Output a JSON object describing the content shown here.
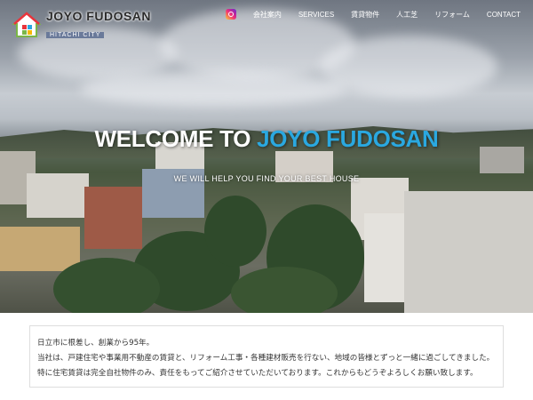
{
  "header": {
    "logo_main": "JOYO FUDOSAN",
    "logo_sub": "HITACHI CITY"
  },
  "nav": {
    "instagram_icon": "instagram-icon",
    "items": [
      {
        "label": "会社案内"
      },
      {
        "label": "SERVICES"
      },
      {
        "label": "賃貸物件"
      },
      {
        "label": "人工芝"
      },
      {
        "label": "リフォーム"
      },
      {
        "label": "CONTACT"
      }
    ]
  },
  "hero": {
    "welcome_prefix": "WELCOME TO",
    "welcome_brand": "JOYO FUDOSAN",
    "tagline": "WE WILL HELP YOU FIND YOUR BEST HOUSE",
    "brand_color": "#2aa8e0"
  },
  "intro": {
    "lines": [
      "日立市に根差し、創業から95年。",
      "当社は、戸建住宅や事業用不動産の賃貸と、リフォーム工事・各種建材販売を行ない、地域の皆様とずっと一緒に過ごしてきました。",
      "特に住宅賃貸は完全自社物件のみ、責任をもってご紹介させていただいております。これからもどうぞよろしくお願い致します。"
    ]
  }
}
